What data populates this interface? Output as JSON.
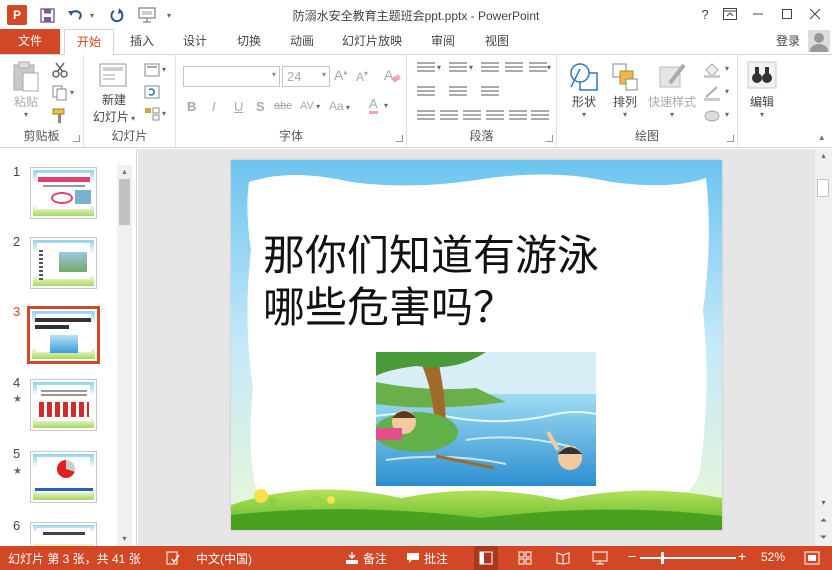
{
  "window": {
    "title": "防溺水安全教育主题班会ppt.pptx - PowerPoint",
    "help_label": "?",
    "colors": {
      "accent": "#d24726",
      "tab_active_text": "#d24726",
      "status_bar": "#d24726"
    }
  },
  "tabs": {
    "file": "文件",
    "items": [
      "开始",
      "插入",
      "设计",
      "切换",
      "动画",
      "幻灯片放映",
      "审阅",
      "视图"
    ],
    "active": "开始",
    "login": "登录"
  },
  "ribbon": {
    "clipboard": {
      "paste": "粘贴",
      "label": "剪贴板"
    },
    "slides": {
      "new_slide_line1": "新建",
      "new_slide_line2": "幻灯片",
      "label": "幻灯片"
    },
    "font": {
      "font_name": "",
      "font_size": "24",
      "label": "字体",
      "grow": "A",
      "shrink": "A",
      "bold": "B",
      "italic": "I",
      "underline": "U",
      "shadow": "S",
      "strike": "abc",
      "spacing": "AV",
      "case": "Aa",
      "color": "A"
    },
    "paragraph": {
      "label": "段落"
    },
    "drawing": {
      "shape": "形状",
      "arrange": "排列",
      "quick_style": "快速样式",
      "label": "绘图"
    },
    "editing": {
      "label": "编辑"
    }
  },
  "thumbnails": [
    {
      "num": "1",
      "star": false,
      "active": false
    },
    {
      "num": "2",
      "star": false,
      "active": false
    },
    {
      "num": "3",
      "star": false,
      "active": true
    },
    {
      "num": "4",
      "star": true,
      "active": false
    },
    {
      "num": "5",
      "star": true,
      "active": false
    },
    {
      "num": "6",
      "star": false,
      "active": false
    }
  ],
  "thumb_star_glyph": "★",
  "slide": {
    "title_line1": "那你们知道有游泳",
    "title_line2": "哪些危害吗？"
  },
  "statusbar": {
    "slide_info": "幻灯片 第 3 张，共 41 张",
    "language": "中文(中国)",
    "notes": "备注",
    "comments": "批注",
    "zoom_minus": "−",
    "zoom_plus": "+",
    "zoom": "52%",
    "zoom_level_percent": 52
  }
}
